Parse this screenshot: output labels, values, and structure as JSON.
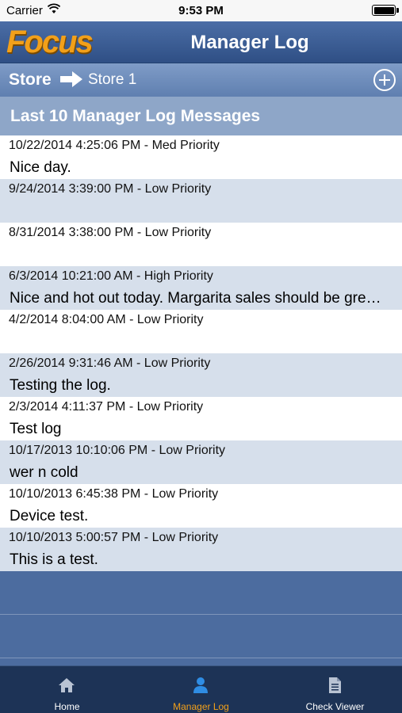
{
  "status": {
    "carrier": "Carrier",
    "time": "9:53 PM"
  },
  "header": {
    "logo": "Focus",
    "title": "Manager Log"
  },
  "store_bar": {
    "label": "Store",
    "value": "Store 1"
  },
  "section": {
    "title": "Last 10 Manager Log Messages"
  },
  "logs": [
    {
      "meta": "10/22/2014 4:25:06 PM - Med Priority",
      "text": "Nice day."
    },
    {
      "meta": "9/24/2014 3:39:00 PM - Low Priority",
      "text": ""
    },
    {
      "meta": "8/31/2014 3:38:00 PM - Low Priority",
      "text": ""
    },
    {
      "meta": "6/3/2014 10:21:00 AM - High Priority",
      "text": "Nice and hot out today. Margarita sales should be gre…"
    },
    {
      "meta": "4/2/2014 8:04:00 AM - Low Priority",
      "text": ""
    },
    {
      "meta": "2/26/2014 9:31:46 AM - Low Priority",
      "text": "Testing the log."
    },
    {
      "meta": "2/3/2014 4:11:37 PM - Low Priority",
      "text": "Test log"
    },
    {
      "meta": "10/17/2013 10:10:06 PM - Low Priority",
      "text": "wer n cold"
    },
    {
      "meta": "10/10/2013 6:45:38 PM - Low Priority",
      "text": "Device test."
    },
    {
      "meta": "10/10/2013 5:00:57 PM - Low Priority",
      "text": "This is a test."
    }
  ],
  "tabs": [
    {
      "label": "Home",
      "icon": "home-icon",
      "active": false
    },
    {
      "label": "Manager Log",
      "icon": "person-icon",
      "active": true
    },
    {
      "label": "Check Viewer",
      "icon": "document-icon",
      "active": false
    }
  ],
  "colors": {
    "accent": "#f2a01a",
    "nav": "#2f4f85",
    "row_alt": "#d6dfeb"
  }
}
